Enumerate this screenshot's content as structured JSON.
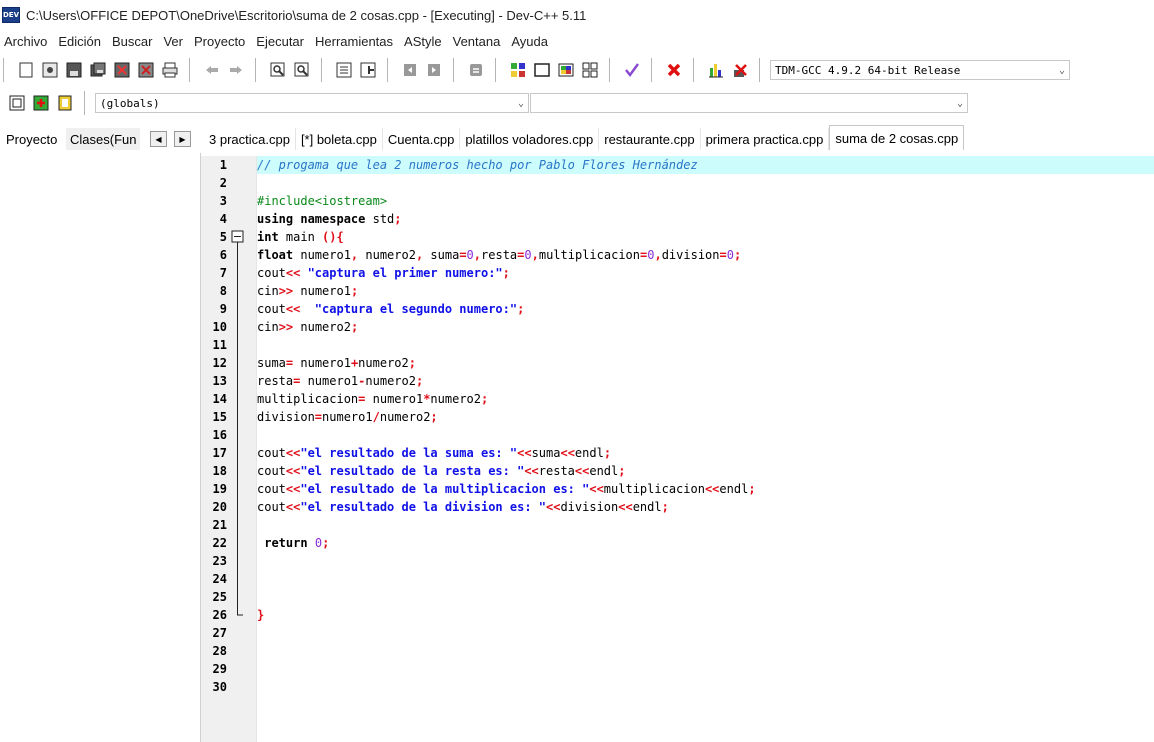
{
  "window": {
    "title": "C:\\Users\\OFFICE DEPOT\\OneDrive\\Escritorio\\suma de 2 cosas.cpp - [Executing] - Dev-C++ 5.11",
    "app_icon_label": "DEV"
  },
  "menu": [
    "Archivo",
    "Edición",
    "Buscar",
    "Ver",
    "Proyecto",
    "Ejecutar",
    "Herramientas",
    "AStyle",
    "Ventana",
    "Ayuda"
  ],
  "toolbar": {
    "compiler": "TDM-GCC 4.9.2 64-bit Release",
    "globals": "(globals)",
    "second_combo": ""
  },
  "icons": [
    "new-file-icon",
    "open-icon",
    "save-icon",
    "save-all-icon",
    "close-icon",
    "close-all-icon",
    "print-icon",
    "undo-icon",
    "redo-icon",
    "find-icon",
    "replace-icon",
    "goto-icon",
    "jump-icon",
    "indent-icon",
    "unindent-icon",
    "toggle-comment-icon",
    "compile-icon",
    "run-icon",
    "compile-run-icon",
    "rebuild-icon",
    "syntax-check-icon",
    "stop-icon",
    "chart-icon",
    "debug-icon",
    "new-class-icon",
    "add-file-icon",
    "remove-file-icon"
  ],
  "left_tabs": {
    "proyecto": "Proyecto",
    "clases": "Clases(Fun"
  },
  "file_tabs": [
    "3 practica.cpp",
    "[*] boleta.cpp",
    "Cuenta.cpp",
    "platillos voladores.cpp",
    "restaurante.cpp",
    "primera practica.cpp",
    "suma de 2 cosas.cpp"
  ],
  "active_tab_index": 6,
  "editor": {
    "line_numbers": [
      "1",
      "2",
      "3",
      "4",
      "5",
      "6",
      "7",
      "8",
      "9",
      "10",
      "11",
      "12",
      "13",
      "14",
      "15",
      "16",
      "17",
      "18",
      "19",
      "20",
      "21",
      "22",
      "23",
      "24",
      "25",
      "26",
      "27",
      "28",
      "29",
      "30"
    ],
    "highlighted_line": 1,
    "lines": [
      [
        [
          "cmt",
          "// progama que lea 2 numeros hecho por Pablo Flores Hernández"
        ]
      ],
      [],
      [
        [
          "pre",
          "#include<iostream>"
        ]
      ],
      [
        [
          "kw",
          "using namespace"
        ],
        [
          "txt",
          " std"
        ],
        [
          "sym",
          ";"
        ]
      ],
      [
        [
          "kw",
          "int"
        ],
        [
          "txt",
          " main "
        ],
        [
          "sym",
          "(){"
        ]
      ],
      [
        [
          "kw",
          "float"
        ],
        [
          "txt",
          " numero1"
        ],
        [
          "sym",
          ","
        ],
        [
          "txt",
          " numero2"
        ],
        [
          "sym",
          ","
        ],
        [
          "txt",
          " suma"
        ],
        [
          "sym",
          "="
        ],
        [
          "num",
          "0"
        ],
        [
          "sym",
          ","
        ],
        [
          "txt",
          "resta"
        ],
        [
          "sym",
          "="
        ],
        [
          "num",
          "0"
        ],
        [
          "sym",
          ","
        ],
        [
          "txt",
          "multiplicacion"
        ],
        [
          "sym",
          "="
        ],
        [
          "num",
          "0"
        ],
        [
          "sym",
          ","
        ],
        [
          "txt",
          "division"
        ],
        [
          "sym",
          "="
        ],
        [
          "num",
          "0"
        ],
        [
          "sym",
          ";"
        ]
      ],
      [
        [
          "txt",
          "cout"
        ],
        [
          "sym",
          "<<"
        ],
        [
          "str",
          " \"captura el primer numero:\""
        ],
        [
          "sym",
          ";"
        ]
      ],
      [
        [
          "txt",
          "cin"
        ],
        [
          "sym",
          ">>"
        ],
        [
          "txt",
          " numero1"
        ],
        [
          "sym",
          ";"
        ]
      ],
      [
        [
          "txt",
          "cout"
        ],
        [
          "sym",
          "<<"
        ],
        [
          "str",
          "  \"captura el segundo numero:\""
        ],
        [
          "sym",
          ";"
        ]
      ],
      [
        [
          "txt",
          "cin"
        ],
        [
          "sym",
          ">>"
        ],
        [
          "txt",
          " numero2"
        ],
        [
          "sym",
          ";"
        ]
      ],
      [],
      [
        [
          "txt",
          "suma"
        ],
        [
          "sym",
          "="
        ],
        [
          "txt",
          " numero1"
        ],
        [
          "sym",
          "+"
        ],
        [
          "txt",
          "numero2"
        ],
        [
          "sym",
          ";"
        ]
      ],
      [
        [
          "txt",
          "resta"
        ],
        [
          "sym",
          "="
        ],
        [
          "txt",
          " numero1"
        ],
        [
          "sym",
          "-"
        ],
        [
          "txt",
          "numero2"
        ],
        [
          "sym",
          ";"
        ]
      ],
      [
        [
          "txt",
          "multiplicacion"
        ],
        [
          "sym",
          "="
        ],
        [
          "txt",
          " numero1"
        ],
        [
          "sym",
          "*"
        ],
        [
          "txt",
          "numero2"
        ],
        [
          "sym",
          ";"
        ]
      ],
      [
        [
          "txt",
          "division"
        ],
        [
          "sym",
          "="
        ],
        [
          "txt",
          "numero1"
        ],
        [
          "sym",
          "/"
        ],
        [
          "txt",
          "numero2"
        ],
        [
          "sym",
          ";"
        ]
      ],
      [],
      [
        [
          "txt",
          "cout"
        ],
        [
          "sym",
          "<<"
        ],
        [
          "str",
          "\"el resultado de la suma es: \""
        ],
        [
          "sym",
          "<<"
        ],
        [
          "txt",
          "suma"
        ],
        [
          "sym",
          "<<"
        ],
        [
          "txt",
          "endl"
        ],
        [
          "sym",
          ";"
        ]
      ],
      [
        [
          "txt",
          "cout"
        ],
        [
          "sym",
          "<<"
        ],
        [
          "str",
          "\"el resultado de la resta es: \""
        ],
        [
          "sym",
          "<<"
        ],
        [
          "txt",
          "resta"
        ],
        [
          "sym",
          "<<"
        ],
        [
          "txt",
          "endl"
        ],
        [
          "sym",
          ";"
        ]
      ],
      [
        [
          "txt",
          "cout"
        ],
        [
          "sym",
          "<<"
        ],
        [
          "str",
          "\"el resultado de la multiplicacion es: \""
        ],
        [
          "sym",
          "<<"
        ],
        [
          "txt",
          "multiplicacion"
        ],
        [
          "sym",
          "<<"
        ],
        [
          "txt",
          "endl"
        ],
        [
          "sym",
          ";"
        ]
      ],
      [
        [
          "txt",
          "cout"
        ],
        [
          "sym",
          "<<"
        ],
        [
          "str",
          "\"el resultado de la division es: \""
        ],
        [
          "sym",
          "<<"
        ],
        [
          "txt",
          "division"
        ],
        [
          "sym",
          "<<"
        ],
        [
          "txt",
          "endl"
        ],
        [
          "sym",
          ";"
        ]
      ],
      [],
      [
        [
          "txt",
          " "
        ],
        [
          "kw",
          "return"
        ],
        [
          "txt",
          " "
        ],
        [
          "num",
          "0"
        ],
        [
          "sym",
          ";"
        ]
      ],
      [],
      [],
      [],
      [
        [
          "sym",
          "}"
        ]
      ],
      [],
      [],
      [],
      []
    ]
  }
}
